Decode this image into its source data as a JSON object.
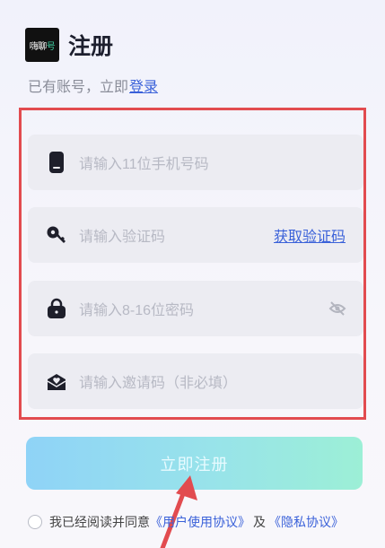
{
  "header": {
    "logo_text_a": "嗨",
    "logo_text_b": "聊",
    "logo_text_c": "号",
    "title": "注册"
  },
  "subline": {
    "prefix": "已有账号，立即",
    "login_link": "登录"
  },
  "fields": {
    "phone_placeholder": "请输入11位手机号码",
    "code_placeholder": "请输入验证码",
    "code_action": "获取验证码",
    "password_placeholder": "请输入8-16位密码",
    "invite_placeholder": "请输入邀请码（非必填）"
  },
  "submit_label": "立即注册",
  "agreement": {
    "prefix": "我已经阅读并同意",
    "user_agreement": "《用户使用协议》",
    "and": "及",
    "privacy": "《隐私协议》"
  },
  "colors": {
    "link": "#3a61d9",
    "highlight_border": "#e24b4f",
    "annotation_arrow": "#e24b4f"
  },
  "icons": [
    "phone-icon",
    "key-icon",
    "lock-icon",
    "eye-off-icon",
    "mail-heart-icon"
  ]
}
